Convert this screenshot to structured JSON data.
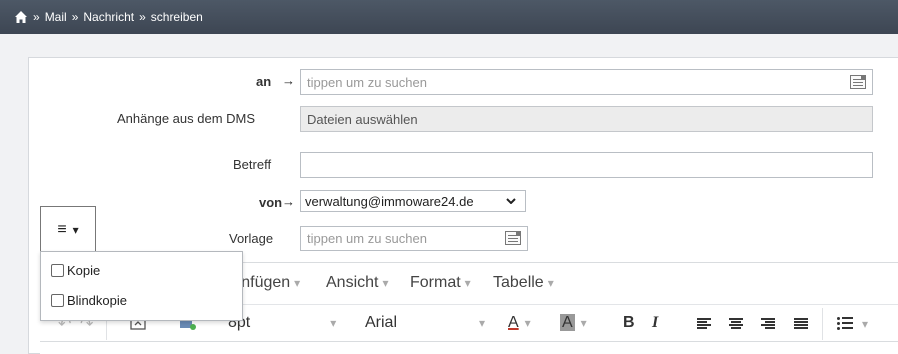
{
  "breadcrumb": {
    "items": [
      "Mail",
      "Nachricht",
      "schreiben"
    ],
    "separator": "»"
  },
  "form": {
    "to": {
      "label": "an",
      "arrow": "→",
      "placeholder": "tippen um zu suchen"
    },
    "attachments": {
      "label": "Anhänge aus dem DMS",
      "value": "Dateien auswählen"
    },
    "subject": {
      "label": "Betreff",
      "value": ""
    },
    "from": {
      "label": "von",
      "arrow": "→",
      "value": "verwaltung@immoware24.de"
    },
    "template": {
      "label": "Vorlage",
      "placeholder": "tippen um zu suchen"
    }
  },
  "format_button": {
    "icon": "≡",
    "caret": "▾"
  },
  "dropdown_menu": {
    "items": [
      {
        "label": "Kopie",
        "checked": false
      },
      {
        "label": "Blindkopie",
        "checked": false
      }
    ]
  },
  "editor": {
    "menubar": [
      {
        "label": "Einfügen"
      },
      {
        "label": "Ansicht"
      },
      {
        "label": "Format"
      },
      {
        "label": "Tabelle"
      }
    ],
    "toolbar": {
      "font_size": "8pt",
      "font_family": "Arial",
      "text_color": "A",
      "bg_color": "A",
      "bold": "B",
      "italic": "I"
    }
  },
  "colors": {
    "topbar": "#434c59",
    "text_color_underline": "#c0392b",
    "bg_color_highlight": "#999999"
  }
}
